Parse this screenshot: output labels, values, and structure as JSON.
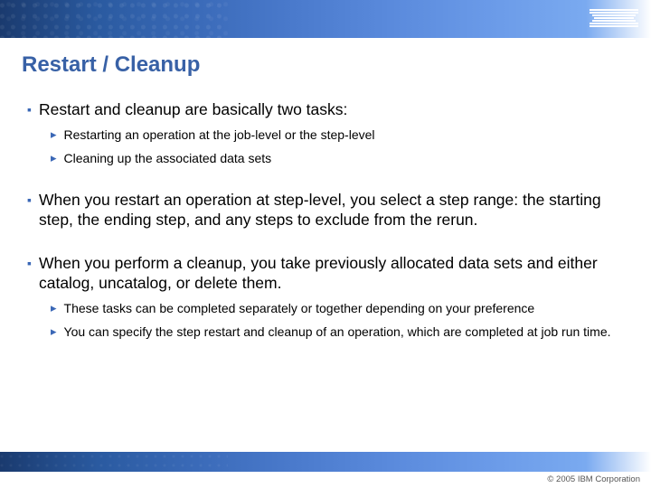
{
  "header": {
    "logo_name": "ibm-logo"
  },
  "title": "Restart / Cleanup",
  "content": {
    "items": [
      {
        "level": 1,
        "text": "Restart and cleanup are basically two tasks:"
      },
      {
        "level": 2,
        "text": "Restarting an operation at the job-level or the step-level"
      },
      {
        "level": 2,
        "text": "Cleaning up the associated data sets"
      },
      {
        "level": 0
      },
      {
        "level": 1,
        "text": "When you restart an operation at step-level, you select a step range: the starting step, the ending step, and any steps to exclude from the rerun."
      },
      {
        "level": 0
      },
      {
        "level": 1,
        "text": "When you perform a cleanup, you take previously allocated data sets and either catalog, uncatalog, or delete them."
      },
      {
        "level": 2,
        "text": "These tasks can be completed separately or together depending on your preference"
      },
      {
        "level": 2,
        "text": "You can specify the step restart and cleanup of an operation, which are completed at job run time."
      }
    ]
  },
  "footer": {
    "copyright": "© 2005 IBM Corporation"
  }
}
